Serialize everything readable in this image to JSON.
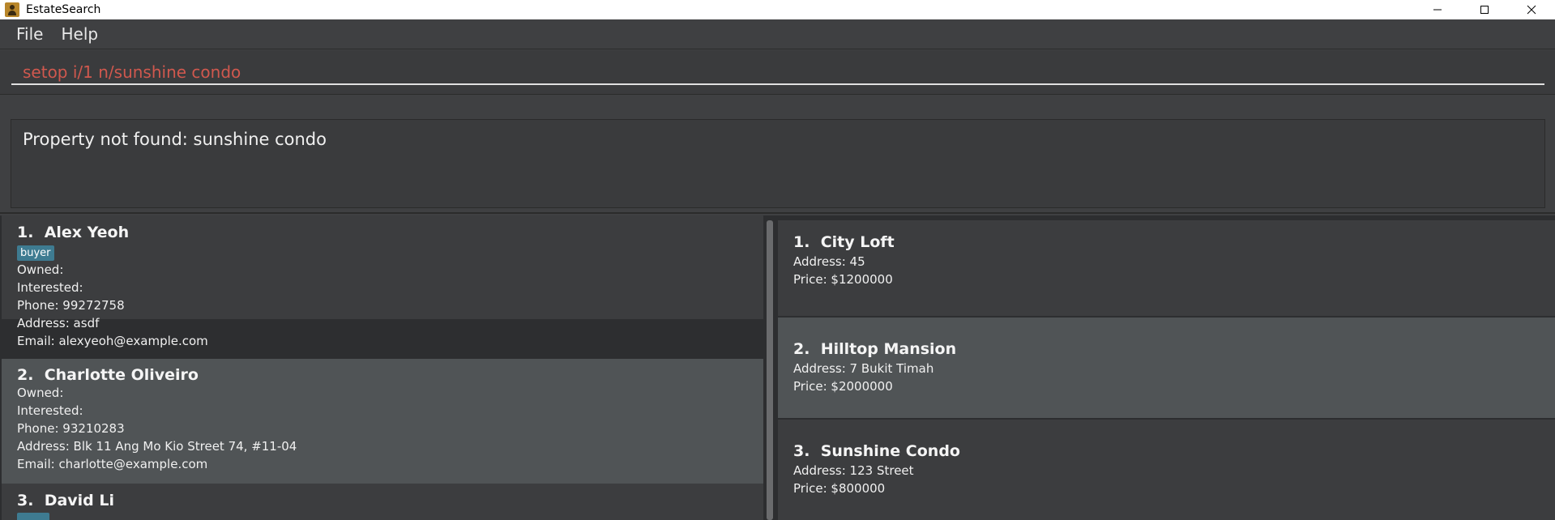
{
  "window": {
    "title": "EstateSearch"
  },
  "menu": {
    "file": "File",
    "help": "Help"
  },
  "command": {
    "value": "setop i/1 n/sunshine condo"
  },
  "result": {
    "message": "Property not found: sunshine condo"
  },
  "persons": [
    {
      "index": "1.",
      "name": "Alex Yeoh",
      "tag": "buyer",
      "owned": "Owned:",
      "interested": "Interested:",
      "phone": "Phone: 99272758",
      "address": "Address: asdf",
      "email": "Email: alexyeoh@example.com"
    },
    {
      "index": "2.",
      "name": "Charlotte Oliveiro",
      "owned": "Owned:",
      "interested": "Interested:",
      "phone": "Phone: 93210283",
      "address": "Address: Blk 11 Ang Mo Kio Street 74, #11-04",
      "email": "Email: charlotte@example.com"
    },
    {
      "index": "3.",
      "name": "David Li"
    }
  ],
  "properties": [
    {
      "index": "1.",
      "name": "City Loft",
      "address": "Address: 45",
      "price": "Price: $1200000"
    },
    {
      "index": "2.",
      "name": "Hilltop Mansion",
      "address": "Address: 7 Bukit Timah",
      "price": "Price: $2000000"
    },
    {
      "index": "3.",
      "name": "Sunshine Condo",
      "address": "Address: 123 Street",
      "price": "Price: $800000"
    }
  ],
  "colors": {
    "background": "#3f4042",
    "selected_card": "#505456",
    "tag": "#3e7b91",
    "command_text": "#d0584e"
  }
}
